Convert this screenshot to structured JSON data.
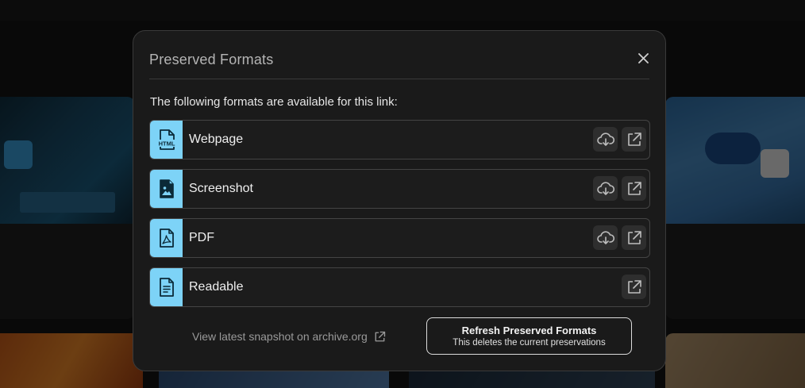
{
  "modal": {
    "title": "Preserved Formats",
    "intro": "The following formats are available for this link:",
    "close_icon": "close-icon",
    "formats": [
      {
        "label": "Webpage",
        "icon": "html-file-icon",
        "icon_text": "HTML",
        "download": true,
        "open": true
      },
      {
        "label": "Screenshot",
        "icon": "image-file-icon",
        "download": true,
        "open": true
      },
      {
        "label": "PDF",
        "icon": "pdf-file-icon",
        "download": true,
        "open": true
      },
      {
        "label": "Readable",
        "icon": "text-file-icon",
        "download": false,
        "open": true
      }
    ],
    "archive_link": "View latest snapshot on archive.org",
    "refresh": {
      "label": "Refresh Preserved Formats",
      "sublabel": "This deletes the current preservations"
    }
  },
  "colors": {
    "accent": "#7dd3f7",
    "modal_bg": "#1a1a1a",
    "border": "#444444"
  }
}
